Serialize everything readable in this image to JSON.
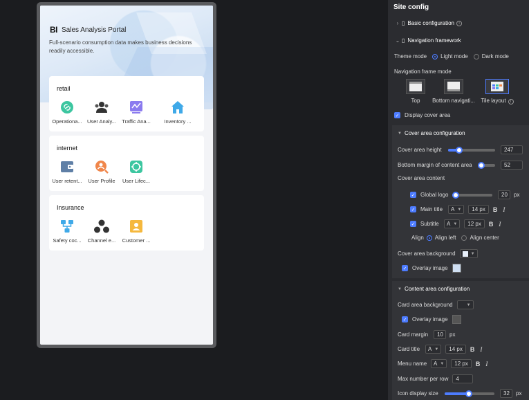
{
  "preview": {
    "logo": "BI",
    "title": "Sales Analysis Portal",
    "subtitle": "Full-scenario consumption data makes business decisions readily accessible.",
    "cards": [
      {
        "title": "retail",
        "items": [
          {
            "label": "Operationa...",
            "icon": "link-icon",
            "color": "#3cc6a0"
          },
          {
            "label": "User Analy...",
            "icon": "users-icon",
            "color": "#333333"
          },
          {
            "label": "Traffic Ana...",
            "icon": "chart-line-icon",
            "color": "#8b7bef"
          },
          {
            "label": "Inventory ...",
            "icon": "home-icon",
            "color": "#3fa9e8"
          }
        ]
      },
      {
        "title": "internet",
        "items": [
          {
            "label": "User retent...",
            "icon": "wallet-icon",
            "color": "#5f7fa6"
          },
          {
            "label": "User Profile",
            "icon": "user-search-icon",
            "color": "#f0864a"
          },
          {
            "label": "User Lifec...",
            "icon": "cycle-icon",
            "color": "#3cc6a0"
          }
        ]
      },
      {
        "title": "Insurance",
        "items": [
          {
            "label": "Safety coc...",
            "icon": "flow-icon",
            "color": "#3fa9e8"
          },
          {
            "label": "Channel e...",
            "icon": "triangle-nodes-icon",
            "color": "#333333"
          },
          {
            "label": "Customer ...",
            "icon": "customer-icon",
            "color": "#f5b83d"
          }
        ]
      }
    ]
  },
  "panel": {
    "title": "Site config",
    "basic_config": "Basic configuration",
    "nav_framework": "Navigation framework",
    "theme_mode": {
      "label": "Theme mode",
      "options": [
        "Light mode",
        "Dark mode"
      ],
      "selected": 0
    },
    "nav_frame_mode": {
      "label": "Navigation frame mode",
      "options": [
        "Top",
        "Bottom navigati...",
        "Tile layout"
      ],
      "selected": 2
    },
    "display_cover": "Display cover area",
    "cover_config": {
      "title": "Cover area configuration",
      "height": {
        "label": "Cover area height",
        "value": "247",
        "fraction": 0.25
      },
      "bottom_margin": {
        "label": "Bottom margin of content area",
        "value": "52",
        "fraction": 0.1
      },
      "content_label": "Cover area content",
      "global_logo": {
        "label": "Global logo",
        "value": "20",
        "unit": "px",
        "fraction": 0.05
      },
      "main_title": {
        "label": "Main title",
        "font": "A",
        "size": "14 px",
        "bold": "B",
        "italic": "I"
      },
      "subtitle": {
        "label": "Subtitle",
        "font": "A",
        "size": "12 px",
        "bold": "B",
        "italic": "I"
      },
      "align": {
        "label": "Align",
        "options": [
          "Align left",
          "Align center"
        ],
        "selected": 0
      },
      "background": "Cover area background",
      "overlay": "Overlay image"
    },
    "content_config": {
      "title": "Content area configuration",
      "card_bg": "Card area background",
      "overlay": "Overlay image",
      "card_margin": {
        "label": "Card margin",
        "value": "10",
        "unit": "px"
      },
      "card_title": {
        "label": "Card title",
        "font": "A",
        "size": "14 px",
        "bold": "B",
        "italic": "I"
      },
      "menu_name": {
        "label": "Menu name",
        "font": "A",
        "size": "12 px",
        "bold": "B",
        "italic": "I"
      },
      "max_per_row": {
        "label": "Max number per row",
        "value": "4"
      },
      "icon_size": {
        "label": "Icon display size",
        "value": "32",
        "unit": "px",
        "fraction": 0.48
      }
    }
  }
}
